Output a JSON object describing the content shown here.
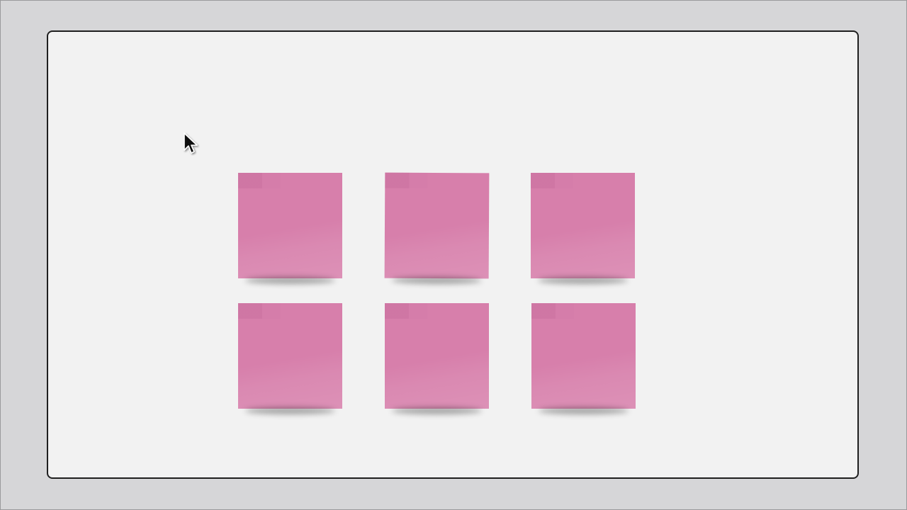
{
  "board": {
    "background": "#f2f2f2",
    "border_color": "#1f1f1f"
  },
  "notes": [
    {
      "color": "#d77fab"
    },
    {
      "color": "#d77fab"
    },
    {
      "color": "#d77fab"
    },
    {
      "color": "#d77fab"
    },
    {
      "color": "#d77fab"
    },
    {
      "color": "#d77fab"
    }
  ],
  "cursor": {
    "icon": "mouse-pointer-icon"
  }
}
